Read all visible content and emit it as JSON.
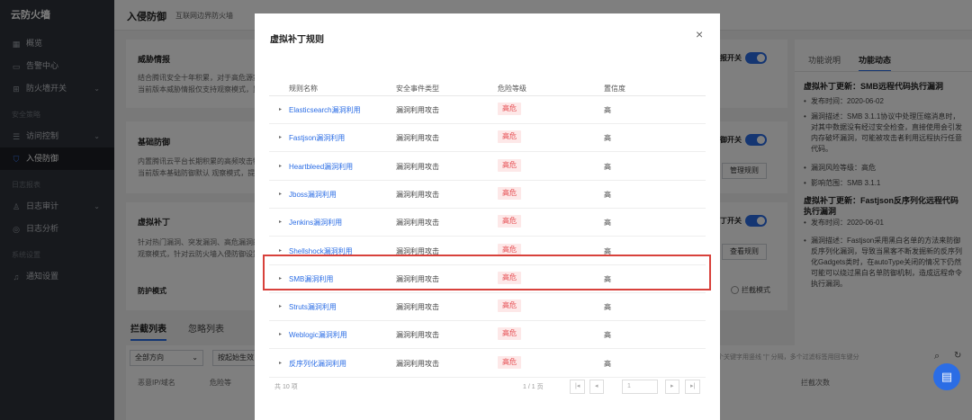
{
  "sidebar": {
    "brand": "云防火墙",
    "items": [
      {
        "icon": "grid-icon",
        "glyph": "▦",
        "label": "概览"
      },
      {
        "icon": "monitor-icon",
        "glyph": "▭",
        "label": "告警中心"
      },
      {
        "icon": "switch-icon",
        "glyph": "⊞",
        "label": "防火墙开关"
      }
    ],
    "section_security": "安全策略",
    "security_items": [
      {
        "icon": "sliders-icon",
        "glyph": "☰",
        "label": "访问控制"
      },
      {
        "icon": "shield-icon",
        "glyph": "⛉",
        "label": "入侵防御"
      }
    ],
    "section_logs": "日志报表",
    "log_items": [
      {
        "icon": "user-icon",
        "glyph": "♙",
        "label": "日志审计"
      },
      {
        "icon": "analysis-icon",
        "glyph": "◎",
        "label": "日志分析"
      }
    ],
    "section_system": "系统设置",
    "system_items": [
      {
        "icon": "bell-icon",
        "glyph": "♫",
        "label": "通知设置"
      }
    ]
  },
  "header": {
    "title": "入侵防御",
    "subtitle": "互联网边界防火墙"
  },
  "cards": {
    "threat_intel": {
      "title": "威胁情报",
      "desc1": "结合腾讯安全十年积累，对于高危源家",
      "desc2": "当前版本威胁情报仅支持观察模式，累"
    },
    "basic_defense": {
      "title": "基础防御",
      "desc1": "内置腾讯云平台长期积累的高频攻击特",
      "desc2": "当前版本基础防御默认 观察模式，提供",
      "button": "管理规则"
    },
    "virtual_patch": {
      "title": "虚拟补丁",
      "desc1": "针对热门漏洞、突发漏洞、高危漏洞的",
      "desc2": "观察模式，针对云防火墙入侵防御设置",
      "button": "查看规则",
      "toggle_label": "丁开关"
    },
    "defense_mode": {
      "title": "防护模式",
      "option": "拦截模式"
    },
    "toggle_top_label": "报开关",
    "toggle_mid_label": "御开关"
  },
  "right_panel": {
    "tabs": [
      "功能说明",
      "功能动态"
    ],
    "active_tab": "功能动态",
    "news": [
      {
        "title": "虚拟补丁更新：SMB远程代码执行漏洞",
        "items": [
          "发布时间：2020-06-02",
          "漏洞描述：SMB 3.1.1协议中处理压缩消息时，对其中数据没有经过安全检查，直接使用会引发内存破坏漏洞，可能被攻击者利用远程执行任意代码。",
          "漏洞风险等级：高危",
          "影响范围：SMB 3.1.1"
        ]
      },
      {
        "title": "虚拟补丁更新：Fastjson反序列化远程代码执行漏洞",
        "items": [
          "发布时间：2020-06-01",
          "漏洞描述：Fastjson采用黑白名单的方法来防御反序列化漏洞，导致当黑客不断发掘新的反序列化Gadgets类时，在autoType关闭的情况下仍然可能可以绕过黑白名单防御机制，造成远程命令执行漏洞。"
        ]
      }
    ]
  },
  "bottom": {
    "tabs": [
      "拦截列表",
      "忽略列表"
    ],
    "direction_select": "全部方向",
    "time_select": "按起始生效",
    "search_placeholder": "多个关键字用竖线 \"|\" 分隔，多个过滤标签用回车键分",
    "col_source": "恶意IP/域名",
    "col_risk": "危险等",
    "col_count": "拦截次数"
  },
  "modal": {
    "title": "虚拟补丁规则",
    "close": "×",
    "columns": [
      "规则名称",
      "安全事件类型",
      "危险等级",
      "置信度"
    ],
    "rows": [
      {
        "name": "Elasticsearch漏洞利用",
        "type": "漏洞利用攻击",
        "risk": "高危",
        "confidence": "高"
      },
      {
        "name": "Fastjson漏洞利用",
        "type": "漏洞利用攻击",
        "risk": "高危",
        "confidence": "高"
      },
      {
        "name": "Heartbleed漏洞利用",
        "type": "漏洞利用攻击",
        "risk": "高危",
        "confidence": "高"
      },
      {
        "name": "Jboss漏洞利用",
        "type": "漏洞利用攻击",
        "risk": "高危",
        "confidence": "高"
      },
      {
        "name": "Jenkins漏洞利用",
        "type": "漏洞利用攻击",
        "risk": "高危",
        "confidence": "高"
      },
      {
        "name": "Shellshock漏洞利用",
        "type": "漏洞利用攻击",
        "risk": "高危",
        "confidence": "高"
      },
      {
        "name": "SMB漏洞利用",
        "type": "漏洞利用攻击",
        "risk": "高危",
        "confidence": "高"
      },
      {
        "name": "Struts漏洞利用",
        "type": "漏洞利用攻击",
        "risk": "高危",
        "confidence": "高"
      },
      {
        "name": "Weblogic漏洞利用",
        "type": "漏洞利用攻击",
        "risk": "高危",
        "confidence": "高"
      },
      {
        "name": "反序列化漏洞利用",
        "type": "漏洞利用攻击",
        "risk": "高危",
        "confidence": "高"
      }
    ],
    "pager": {
      "total": "共 10 项",
      "page_info": "1 / 1 页"
    }
  },
  "colors": {
    "accent": "#2b6de5",
    "danger": "#e5484d",
    "highlight": "#d8413b",
    "sidebar_bg": "#2f333b"
  }
}
